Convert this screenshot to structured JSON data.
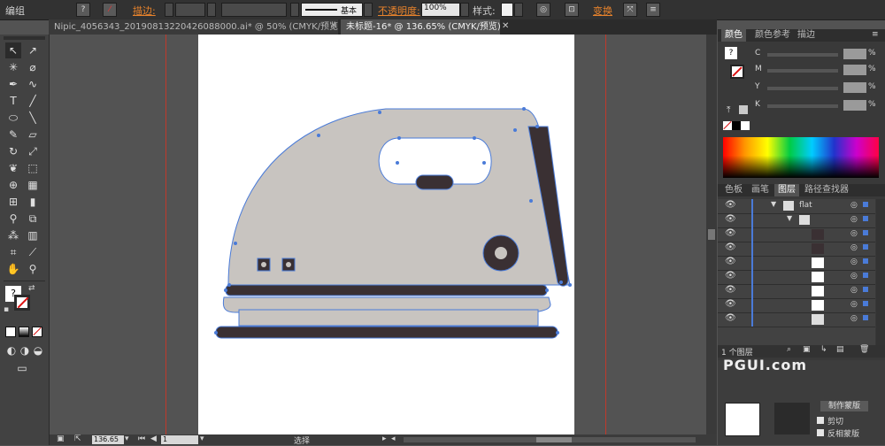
{
  "menu": {
    "mode_label": "编组"
  },
  "control_bar": {
    "stroke_label": "描边:",
    "brush_label": "基本",
    "opacity_label": "不透明度:",
    "opacity_value": "100%",
    "style_label": "样式:",
    "transform_label": "变换"
  },
  "tabs": [
    {
      "label": "Nipic_4056343_20190813220426088000.ai* @ 50% (CMYK/预览)"
    },
    {
      "label": "未标题-16* @ 136.65% (CMYK/预览)"
    }
  ],
  "status": {
    "zoom": "136.65",
    "page": "1",
    "mode": "选择"
  },
  "color_panel": {
    "tabs": [
      "颜色",
      "颜色参考",
      "描边"
    ],
    "channels": [
      "C",
      "M",
      "Y",
      "K"
    ]
  },
  "layers_panel": {
    "tabs": [
      "色板",
      "画笔",
      "图层",
      "路径查找器"
    ],
    "layer_name": "flat",
    "count_label": "1 个图层"
  },
  "bottom_panel": {
    "make_mask": "制作蒙版",
    "clip": "剪切",
    "invert": "反相蒙版"
  },
  "watermark": {
    "text": "PGUI.com"
  },
  "colors": {
    "accent": "#e8832c",
    "selection": "#4a7bd8",
    "iron_body": "#c8c4c0",
    "iron_dark": "#3a3033"
  }
}
